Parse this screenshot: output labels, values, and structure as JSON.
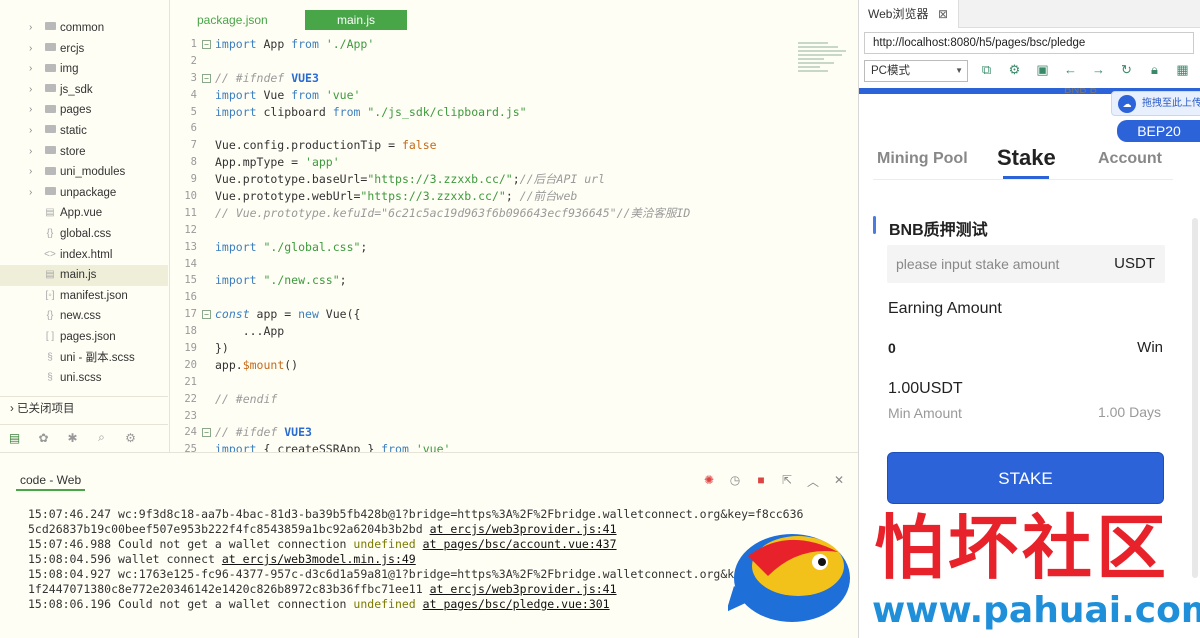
{
  "sidebar": {
    "items": [
      {
        "label": "common",
        "type": "folder",
        "chev": "›"
      },
      {
        "label": "ercjs",
        "type": "folder",
        "chev": "›"
      },
      {
        "label": "img",
        "type": "folder",
        "chev": "›"
      },
      {
        "label": "js_sdk",
        "type": "folder",
        "chev": "›"
      },
      {
        "label": "pages",
        "type": "folder",
        "chev": "›"
      },
      {
        "label": "static",
        "type": "folder",
        "chev": "›"
      },
      {
        "label": "store",
        "type": "folder",
        "chev": "›"
      },
      {
        "label": "uni_modules",
        "type": "folder",
        "chev": "›"
      },
      {
        "label": "unpackage",
        "type": "folder",
        "chev": "›"
      },
      {
        "label": "App.vue",
        "type": "file",
        "icon": "▤"
      },
      {
        "label": "global.css",
        "type": "file",
        "icon": "{}"
      },
      {
        "label": "index.html",
        "type": "file",
        "icon": "<>"
      },
      {
        "label": "main.js",
        "type": "file",
        "icon": "▤",
        "selected": true
      },
      {
        "label": "manifest.json",
        "type": "file",
        "icon": "[◦]"
      },
      {
        "label": "new.css",
        "type": "file",
        "icon": "{}"
      },
      {
        "label": "pages.json",
        "type": "file",
        "icon": "[ ]"
      },
      {
        "label": "uni - 副本.scss",
        "type": "file",
        "icon": "§"
      },
      {
        "label": "uni.scss",
        "type": "file",
        "icon": "§"
      }
    ],
    "closed_projects": "› 已关闭项目"
  },
  "editor_tabs": {
    "tab1": "package.json",
    "tab2": "main.js"
  },
  "code_lines": [
    {
      "n": "1",
      "fold": true,
      "html": "<span class='kw'>import</span> App <span class='kw'>from</span> <span class='str'>'./App'</span>"
    },
    {
      "n": "2",
      "html": ""
    },
    {
      "n": "3",
      "fold": true,
      "html": "<span class='cm'>// #ifndef</span> <span class='ifd'>VUE3</span>"
    },
    {
      "n": "4",
      "html": "<span class='kw'>import</span> Vue <span class='kw'>from</span> <span class='str'>'vue'</span>"
    },
    {
      "n": "5",
      "html": "<span class='kw'>import</span> clipboard <span class='kw'>from</span> <span class='str'>\"./js_sdk/clipboard.js\"</span>"
    },
    {
      "n": "6",
      "html": ""
    },
    {
      "n": "7",
      "html": "Vue.config.productionTip = <span class='const'>false</span>"
    },
    {
      "n": "8",
      "html": "App.mpType = <span class='str'>'app'</span>"
    },
    {
      "n": "9",
      "html": "Vue.prototype.baseUrl=<span class='str'>\"https://3.zzxxb.cc/\"</span>;<span class='cm'>//后台API url</span>"
    },
    {
      "n": "10",
      "html": "Vue.prototype.webUrl=<span class='str'>\"https://3.zzxxb.cc/\"</span>; <span class='cm'>//前台web</span>"
    },
    {
      "n": "11",
      "html": "<span class='cm'>// Vue.prototype.kefuId=\"6c21c5ac19d963f6b096643ecf936645\"//美洽客服ID</span>"
    },
    {
      "n": "12",
      "html": ""
    },
    {
      "n": "13",
      "html": "<span class='kw'>import</span> <span class='str'>\"./global.css\"</span>;"
    },
    {
      "n": "14",
      "html": ""
    },
    {
      "n": "15",
      "html": "<span class='kw'>import</span> <span class='str'>\"./new.css\"</span>;"
    },
    {
      "n": "16",
      "html": ""
    },
    {
      "n": "17",
      "fold": true,
      "html": "<span class='kwi'>const</span> app = <span class='kw'>new</span> Vue({"
    },
    {
      "n": "18",
      "html": "    ...App"
    },
    {
      "n": "19",
      "html": "})"
    },
    {
      "n": "20",
      "html": "app.<span class='const'>$mount</span>()"
    },
    {
      "n": "21",
      "html": ""
    },
    {
      "n": "22",
      "html": "<span class='cm'>// #endif</span>"
    },
    {
      "n": "23",
      "html": ""
    },
    {
      "n": "24",
      "fold": true,
      "html": "<span class='cm'>// #ifdef</span> <span class='ifd'>VUE3</span>"
    },
    {
      "n": "25",
      "html": "<span class='kw'>import</span> { createSSRApp } <span class='kw'>from</span> <span class='str'>'vue'</span>"
    }
  ],
  "console": {
    "title": "code - Web",
    "lines": [
      "15:07:46.247 wc:9f3d8c18-aa7b-4bac-81d3-ba39b5fb428b@1?bridge=https%3A%2F%2Fbridge.walletconnect.org&key=f8cc636",
      "5cd26837b19c00beef507e953b222f4fc8543859a1bc92a6204b3b2bd <u>at ercjs/web3provider.js:41</u>",
      "15:07:46.988 Could not get a wallet connection <un>undefined</un> <u>at pages/bsc/account.vue:437</u>",
      "15:08:04.596 wallet connect <u>at ercjs/web3model.min.js:49</u>",
      "15:08:04.927 wc:1763e125-fc96-4377-957c-d3c6d1a59a81@1?bridge=https%3A%2F%2Fbridge.walletconnect.org&key=f32760",
      "1f2447071380c8e772e20346142e1420c826b8972c83b36ffbc71ee11 <u>at ercjs/web3provider.js:41</u>",
      "15:08:06.196 Could not get a wallet connection <un>undefined</un> <u>at pages/bsc/pledge.vue:301</u>"
    ]
  },
  "browser": {
    "tab_title": "Web浏览器",
    "tab_close": "⊠",
    "url": "http://localhost:8080/h5/pages/bsc/pledge",
    "mode": "PC模式",
    "drag_tip": "拖拽至此上传",
    "bnb_label": "BNB B",
    "badge": "BEP20",
    "nav": {
      "mining": "Mining Pool",
      "stake": "Stake",
      "account": "Account"
    },
    "section_title": "BNB质押测试",
    "input_placeholder": "please input stake amount",
    "input_unit": "USDT",
    "earning_label": "Earning Amount",
    "earning_value": "0",
    "earning_unit": "Win",
    "min_value": "1.00USDT",
    "min_label": "Min Amount",
    "days": "1.00 Days",
    "stake_button": "STAKE"
  },
  "watermark": {
    "cn": "怕坏社区",
    "url": "www.pahuai.com"
  },
  "colors": {
    "accent": "#48a548",
    "primary": "#2c63d8",
    "watermark_red": "#e8222a",
    "watermark_blue": "#1e8fd8"
  }
}
